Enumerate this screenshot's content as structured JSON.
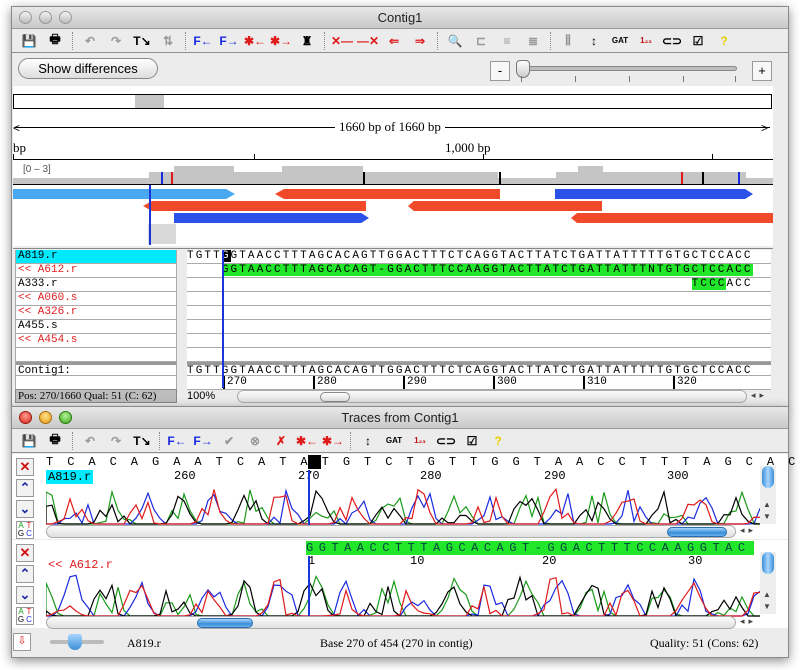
{
  "window1": {
    "title": "Contig1",
    "toolbar": [
      {
        "icon": "save-icon",
        "glyph": "💾"
      },
      {
        "icon": "print-icon",
        "glyph": "🖶"
      },
      {
        "sep": true
      },
      {
        "icon": "undo-icon",
        "glyph": "↶"
      },
      {
        "icon": "redo-icon",
        "glyph": "↷"
      },
      {
        "icon": "goto-icon",
        "glyph": "T↘"
      },
      {
        "icon": "swap-icon",
        "glyph": "⇅"
      },
      {
        "sep": true
      },
      {
        "icon": "find-prev-f-icon",
        "glyph": "F←"
      },
      {
        "icon": "find-next-f-icon",
        "glyph": "F→"
      },
      {
        "icon": "prev-star-icon",
        "glyph": "✱←"
      },
      {
        "icon": "next-star-icon",
        "glyph": "✱→"
      },
      {
        "icon": "robot-icon",
        "glyph": "♜"
      },
      {
        "sep": true
      },
      {
        "icon": "trim-left-icon",
        "glyph": "✕—"
      },
      {
        "icon": "trim-right-icon",
        "glyph": "—✕"
      },
      {
        "icon": "prev-diff-icon",
        "glyph": "⇐"
      },
      {
        "icon": "next-diff-icon",
        "glyph": "⇒"
      },
      {
        "sep": true
      },
      {
        "icon": "zoom-icon",
        "glyph": "🔍"
      },
      {
        "icon": "tree-icon",
        "glyph": "⊏"
      },
      {
        "icon": "align-icon",
        "glyph": "≡"
      },
      {
        "icon": "align2-icon",
        "glyph": "≣"
      },
      {
        "sep": true
      },
      {
        "icon": "trace-icon",
        "glyph": "⫼"
      },
      {
        "icon": "vertical-move-icon",
        "glyph": "↕"
      },
      {
        "icon": "translate-icon",
        "glyph": "GAT"
      },
      {
        "icon": "numbering-icon",
        "glyph": "1₂₃"
      },
      {
        "icon": "link-icon",
        "glyph": "⊂⊃"
      },
      {
        "icon": "checklist-icon",
        "glyph": "☑"
      },
      {
        "icon": "help-icon",
        "glyph": "?"
      }
    ],
    "show_differences_label": "Show differences",
    "zoom_minus": "-",
    "zoom_plus": "+",
    "zoom_slider_value": 0.0,
    "overview": {
      "length_label": "1660 bp of 1660 bp",
      "ruler_left_label": "bp",
      "ruler_1000_label": "1,000 bp",
      "coverage_range": "[0 – 3]"
    },
    "reads": [
      {
        "name": "A819.r",
        "selected": true,
        "reverse": false
      },
      {
        "name": "<< A612.r",
        "selected": false,
        "reverse": true
      },
      {
        "name": "A333.r",
        "selected": false,
        "reverse": false
      },
      {
        "name": "<< A060.s",
        "selected": false,
        "reverse": true
      },
      {
        "name": "<< A326.r",
        "selected": false,
        "reverse": true
      },
      {
        "name": "A455.s",
        "selected": false,
        "reverse": false
      },
      {
        "name": "<< A454.s",
        "selected": false,
        "reverse": true
      },
      {
        "name": "",
        "selected": false,
        "reverse": false
      }
    ],
    "sequences": [
      "TGTTGGTAACCTTTAGCACAGTTGGACTTTCTCAGGTACTTATCTGATTATTTTTGTGCTCCACC",
      "    GGTAACCTTTAGCACAGT-GGACTTTCCAAGGTACTTATCTGATTATTTNTGTGCTCCACC",
      "                                                          TCCCACC",
      "",
      "",
      "",
      "",
      ""
    ],
    "consensus_label": "Contig1:",
    "consensus": "TGTTGGTAACCTTTAGCACAGTTGGACTTTCTCAGGTACTTATCTGATTATTTTTGTGCTCCACC",
    "positions": [
      "270",
      "280",
      "290",
      "300",
      "310",
      "320"
    ],
    "status": "Pos: 270/1660  Qual: 51 (C: 62)",
    "zoom_percent": "100%"
  },
  "window2": {
    "title": "Traces from Contig1",
    "toolbar": [
      {
        "icon": "save-icon",
        "glyph": "💾"
      },
      {
        "icon": "print-icon",
        "glyph": "🖶"
      },
      {
        "sep": true
      },
      {
        "icon": "undo-icon",
        "glyph": "↶"
      },
      {
        "icon": "redo-icon",
        "glyph": "↷"
      },
      {
        "icon": "goto-icon",
        "glyph": "T↘"
      },
      {
        "sep": true
      },
      {
        "icon": "find-prev-f-icon",
        "glyph": "F←"
      },
      {
        "icon": "find-next-f-icon",
        "glyph": "F→"
      },
      {
        "icon": "accept-icon",
        "glyph": "✔"
      },
      {
        "icon": "reject-icon",
        "glyph": "⊗"
      },
      {
        "icon": "delete-icon",
        "glyph": "✗"
      },
      {
        "icon": "prev-star-icon",
        "glyph": "✱←"
      },
      {
        "icon": "next-star-icon",
        "glyph": "✱→"
      },
      {
        "sep": true
      },
      {
        "icon": "vertical-move-icon",
        "glyph": "↕"
      },
      {
        "icon": "translate-icon",
        "glyph": "GAT"
      },
      {
        "icon": "numbering-icon",
        "glyph": "1₂₃"
      },
      {
        "icon": "link-icon",
        "glyph": "⊂⊃"
      },
      {
        "icon": "checklist-icon",
        "glyph": "☑"
      },
      {
        "icon": "help-icon",
        "glyph": "?"
      }
    ],
    "trace1": {
      "name": "A819.r",
      "bases": "T C A C A G A A T C A T A T G T C T G T T G G T A A C C T T T A G C A C A G T T G G A C T T T C T C A G G T A C T T",
      "positions": [
        "260",
        "270",
        "280",
        "290",
        "300"
      ]
    },
    "trace2": {
      "name": "<< A612.r",
      "bases": "GGTAACCTTTAGCACAGT-GGACTTTCCAAGGTAC",
      "positions": [
        "1",
        "10",
        "20",
        "30"
      ]
    },
    "footer": {
      "read": "A819.r",
      "base": "Base 270 of 454 (270 in contig)",
      "quality": "Quality: 51 (Cons: 62)"
    }
  },
  "colors": {
    "selected_row": "#00e9ff",
    "match_green": "#22e629",
    "reverse_read": "#e02020",
    "forward_read": "#4aa8f0",
    "cursor": "#1a35d8",
    "trace_A": "#1a9a1a",
    "trace_C": "#1a2ae0",
    "trace_G": "#000000",
    "trace_T": "#e01a1a"
  }
}
